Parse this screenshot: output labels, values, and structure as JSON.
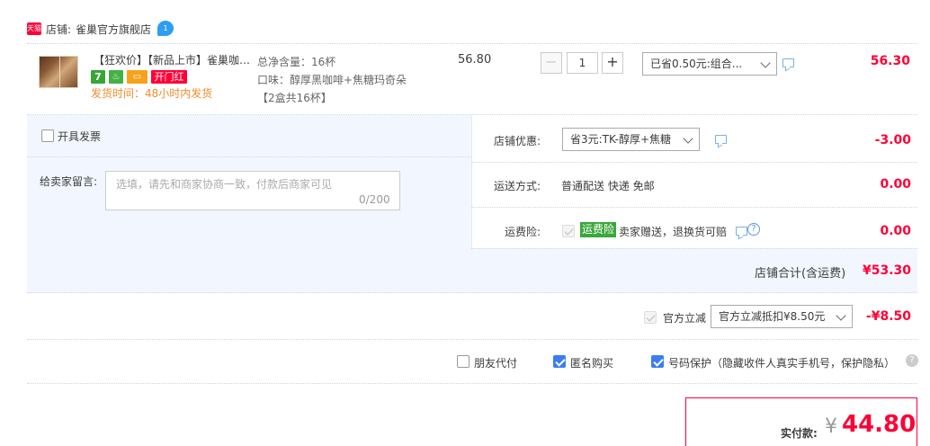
{
  "shop": {
    "badge": "天猫",
    "label": "店铺:",
    "name": "雀巢官方旗舰店",
    "ww_icon_text": "1"
  },
  "item": {
    "title": "【狂欢价】【新品上市】雀巢咖…",
    "badges": {
      "seven": "7",
      "cup": "♨",
      "card": "▭",
      "red": "开门红"
    },
    "ship_time": "发货时间：48小时内发货",
    "spec_total": "总净含量：16杯",
    "spec_flavor": "口味：醇厚黑咖啡+焦糖玛奇朵",
    "spec_pack": "【2盒共16杯】",
    "unit_price": "56.80",
    "qty": "1",
    "qty_minus": "−",
    "qty_plus": "+",
    "promo_select": "已省0.50元:组合...",
    "row_total": "56.30"
  },
  "panel": {
    "invoice_label": "开具发票",
    "message_label": "给卖家留言:",
    "message_placeholder": "选填，请先和商家协商一致，付款后商家可见",
    "message_count": "0/200",
    "shop_discount_label": "店铺优惠:",
    "shop_discount_select": "省3元:TK-醇厚+焦糖",
    "shop_discount_value": "-3.00",
    "ship_label": "运送方式:",
    "ship_method": "普通配送 快递 免邮",
    "ship_fee": "0.00",
    "ins_label": "运费险:",
    "ins_tag": "运费险",
    "ins_text": "卖家赠送，退换货可赔",
    "ins_fee": "0.00",
    "help_icon_text": "?",
    "subtotal_label": "店铺合计(含运费)",
    "subtotal_value": "¥53.30"
  },
  "official": {
    "label": "官方立减",
    "select": "官方立减抵扣¥8.50元",
    "value": "-¥8.50"
  },
  "options": {
    "friend_pay": "朋友代付",
    "anonymous": "匿名购买",
    "phone_protect": "号码保护（隐藏收件人真实手机号，保护隐私）",
    "q_icon_text": "?"
  },
  "payment": {
    "label": "实付款:",
    "currency": "¥",
    "amount": "44.80"
  },
  "colors": {
    "price_red": "#ff0036",
    "panel_blue": "#f2f7ff",
    "checkbox_blue": "#3b7ef2",
    "ship_orange": "#f28c2c"
  }
}
